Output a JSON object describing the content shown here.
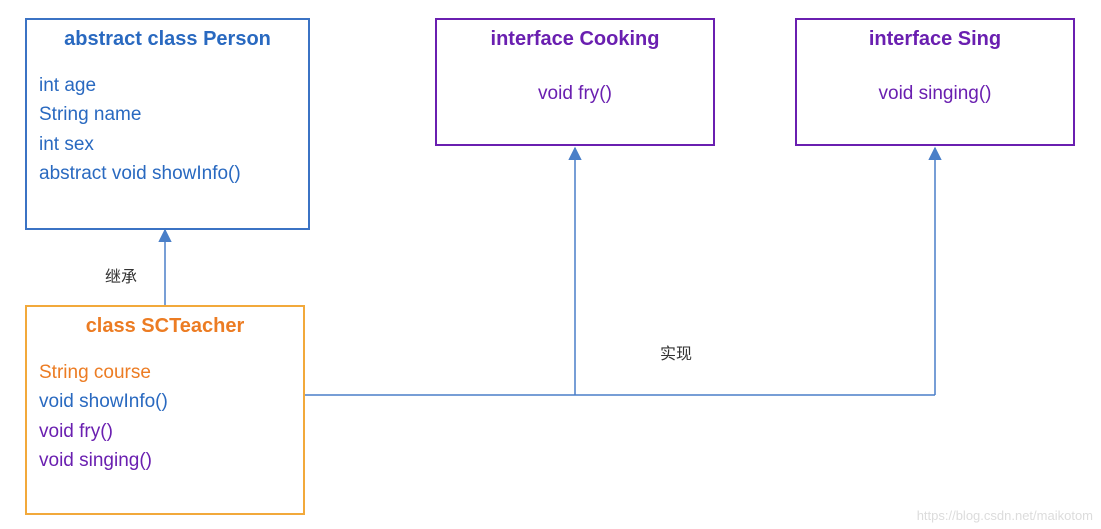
{
  "person": {
    "title": "abstract class Person",
    "members": [
      "int age",
      "String name",
      "int sex",
      "abstract void showInfo()"
    ]
  },
  "cooking": {
    "title": "interface Cooking",
    "method": "void fry()"
  },
  "sing": {
    "title": "interface Sing",
    "method": "void singing()"
  },
  "scteacher": {
    "title": "class SCTeacher",
    "field": "String course",
    "methods": {
      "showInfo": "void showInfo()",
      "fry": "void fry()",
      "singing": "void singing()"
    }
  },
  "labels": {
    "inherit": "继承",
    "implement": "实现"
  },
  "watermark": "https://blog.csdn.net/maikotom"
}
